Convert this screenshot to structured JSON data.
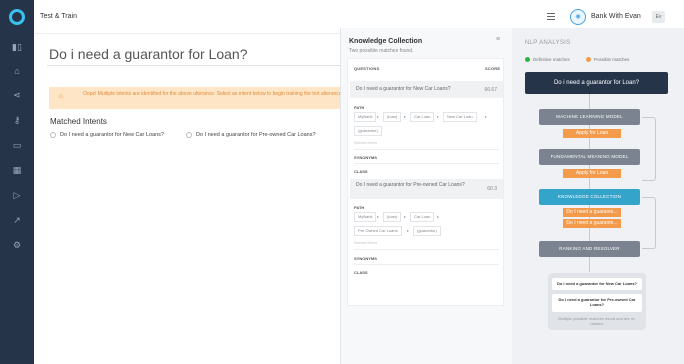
{
  "app_title": "Test & Train",
  "bot": {
    "icon": "bot-icon",
    "name": "Bank With Evan",
    "avatar": "Ev"
  },
  "rail": [
    "chart-icon",
    "home-icon",
    "flow-icon",
    "key-icon",
    "chat-icon",
    "grid-icon",
    "play-icon",
    "analytics-icon",
    "settings-icon"
  ],
  "main": {
    "utterance": "Do i need a guarantor for Loan?",
    "warning": "Oops! Multiple intents are identified for the above utterance. Select an intent below to begin training the bot utterance.",
    "matched_title": "Matched Intents",
    "options": [
      "Do I need a guarantor for New Car Loans?",
      "Do I need a guarantor for Pre-owned Car Loans?"
    ]
  },
  "knowledge": {
    "title": "Knowledge Collection",
    "subtitle": "Two possible matches found.",
    "col_questions": "QUESTIONS",
    "col_score": "SCORE",
    "matches": [
      {
        "question": "Do I need a guarantor for New Car Loans?",
        "score": "66.67",
        "path_label": "PATH",
        "path": [
          "MyBank",
          "(loan)",
          "Car Loan",
          "New Car Loan",
          "(guarantor)"
        ],
        "matched_terms": "Matched Items",
        "synonyms": "SYNONYMS",
        "class": "CLASS"
      },
      {
        "question": "Do I need a guarantor for Pre-owned Car Loans?",
        "score": "60.3",
        "path_label": "PATH",
        "path": [
          "MyBank",
          "(loan)",
          "Car Loan",
          "Pre Owned Car Loans",
          "(guarantor)"
        ],
        "matched_terms": "Matched Items",
        "synonyms": "SYNONYMS",
        "class": "CLASS"
      }
    ]
  },
  "nlp": {
    "title": "NLP ANALYSIS",
    "legend": [
      {
        "label": "Definitive matches",
        "color": "#2fb344"
      },
      {
        "label": "Possible matches",
        "color": "#f39a4b"
      }
    ],
    "utterance": "Do i need a guarantor for Loan?",
    "stages": [
      {
        "name": "MACHINE LEARNING MODEL",
        "badges": [
          "Apply for Loan"
        ]
      },
      {
        "name": "FUNDAMENTAL MEANING MODEL",
        "badges": [
          "Apply for Loan"
        ]
      },
      {
        "name": "KNOWLEDGE COLLECTION",
        "badges": [
          "Do I need a guarante...",
          "Do I need a guarante..."
        ]
      },
      {
        "name": "RANKING AND RESOLVER",
        "badges": []
      }
    ],
    "results": [
      "Do I need a guarantor for New Car Loans?",
      "Do I need a guarantor for Pre-owned Car Loans?"
    ],
    "results_note": "Multiple possible matches found and are re-ranked."
  }
}
